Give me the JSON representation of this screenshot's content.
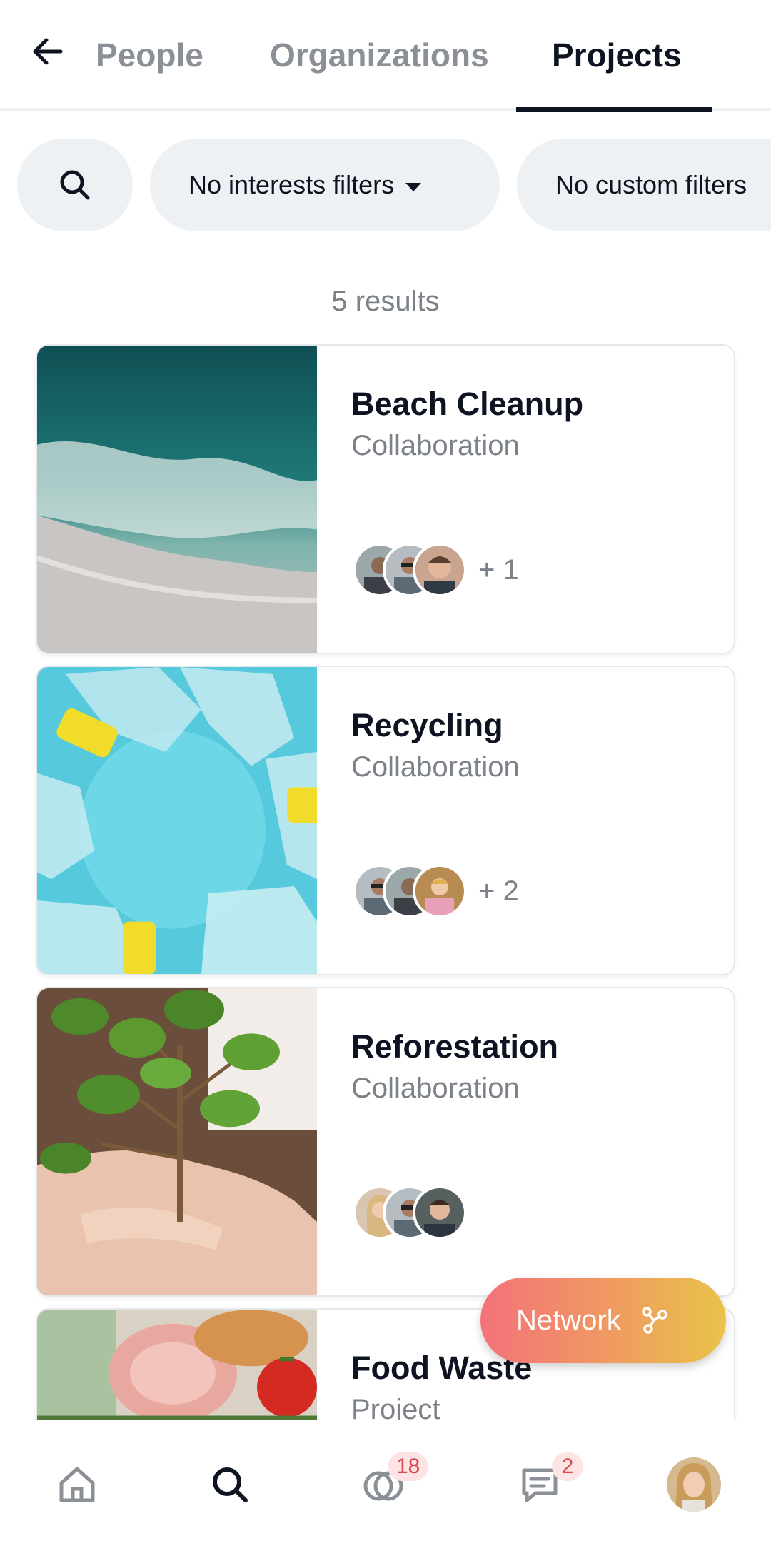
{
  "tabs": {
    "people": "People",
    "organizations": "Organizations",
    "projects": "Projects",
    "active": "Projects"
  },
  "filters": {
    "interests": "No interests filters",
    "custom": "No custom filters"
  },
  "results_text": "5 results",
  "projects": [
    {
      "title": "Beach Cleanup",
      "type": "Collaboration",
      "more": "+ 1"
    },
    {
      "title": "Recycling",
      "type": "Collaboration",
      "more": "+ 2"
    },
    {
      "title": "Reforestation",
      "type": "Collaboration",
      "more": ""
    },
    {
      "title": "Food Waste",
      "type": "Project",
      "more": ""
    }
  ],
  "fab": {
    "label": "Network"
  },
  "nav": {
    "matches_badge": "18",
    "chat_badge": "2"
  },
  "colors": {
    "text_primary": "#0d1321",
    "text_secondary": "#7c8288",
    "chip_bg": "#eef1f4",
    "fab_gradient_start": "#f3727a",
    "fab_gradient_end": "#e9c34a",
    "badge_bg": "#fde4e4",
    "badge_text": "#d9494d"
  }
}
